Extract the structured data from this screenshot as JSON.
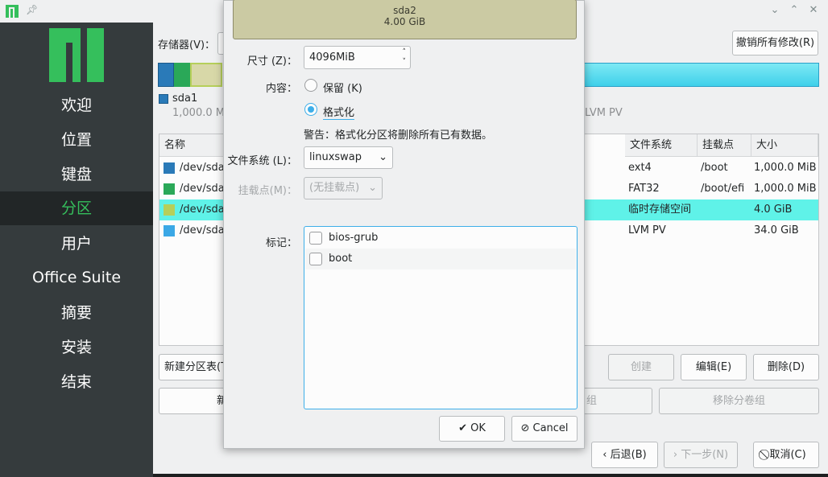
{
  "window": {
    "icons": [
      "app-icon",
      "pin-icon",
      "minimize-icon",
      "maximize-icon",
      "close-icon"
    ]
  },
  "sidebar": {
    "items": [
      {
        "label": "欢迎"
      },
      {
        "label": "位置"
      },
      {
        "label": "键盘"
      },
      {
        "label": "分区",
        "active": true
      },
      {
        "label": "用户"
      },
      {
        "label": "Office Suite"
      },
      {
        "label": "摘要"
      },
      {
        "label": "安装"
      },
      {
        "label": "结束"
      }
    ]
  },
  "main": {
    "storage_label": "存储器(V)：",
    "revert_button": "撤销所有修改(R)",
    "legend": {
      "sda1_name": "sda1",
      "sda1_size": "1,000.0 Mi",
      "lvm_label": "LVM PV"
    },
    "table": {
      "headers": [
        "名称",
        "文件系统",
        "挂载点",
        "大小"
      ],
      "rows": [
        {
          "name": "/dev/sda",
          "fs": "ext4",
          "mount": "/boot",
          "size": "1,000.0 MiB",
          "color": "#2a7ab8"
        },
        {
          "name": "/dev/sda",
          "fs": "FAT32",
          "mount": "/boot/efi",
          "size": "1,000.0 MiB",
          "color": "#2aa858"
        },
        {
          "name": "/dev/sda",
          "fs": "临时存储空间",
          "mount": "",
          "size": "4.0 GiB",
          "color": "#b6cf5a",
          "selected": true
        },
        {
          "name": "/dev/sda",
          "fs": "LVM PV",
          "mount": "",
          "size": "34.0 GiB",
          "color": "#3ba8e6"
        }
      ]
    },
    "buttons": {
      "new_table": "新建分区表(T",
      "new_partial": "新",
      "create": "创建",
      "edit": "编辑(E)",
      "delete": "删除(D)",
      "vg_partial": "组",
      "remove_vg": "移除分卷组"
    },
    "nav": {
      "back": "后退(B)",
      "next": "下一步(N)",
      "cancel": "取消(C)"
    }
  },
  "dialog": {
    "partition_name": "sda2",
    "partition_size": "4.00 GiB",
    "size_label": "尺寸 (Z)：",
    "size_value": "4096MiB",
    "content_label": "内容：",
    "keep_label": "保留 (K)",
    "format_label": "格式化",
    "warning": "警告：格式化分区将删除所有已有数据。",
    "fs_label": "文件系统 (L)：",
    "fs_value": "linuxswap",
    "mount_label": "挂载点(M)：",
    "mount_value": "(无挂载点)",
    "flags_label": "标记：",
    "flags": [
      {
        "label": "bios-grub",
        "checked": false
      },
      {
        "label": "boot",
        "checked": false
      }
    ],
    "ok": "OK",
    "cancel": "Cancel"
  }
}
